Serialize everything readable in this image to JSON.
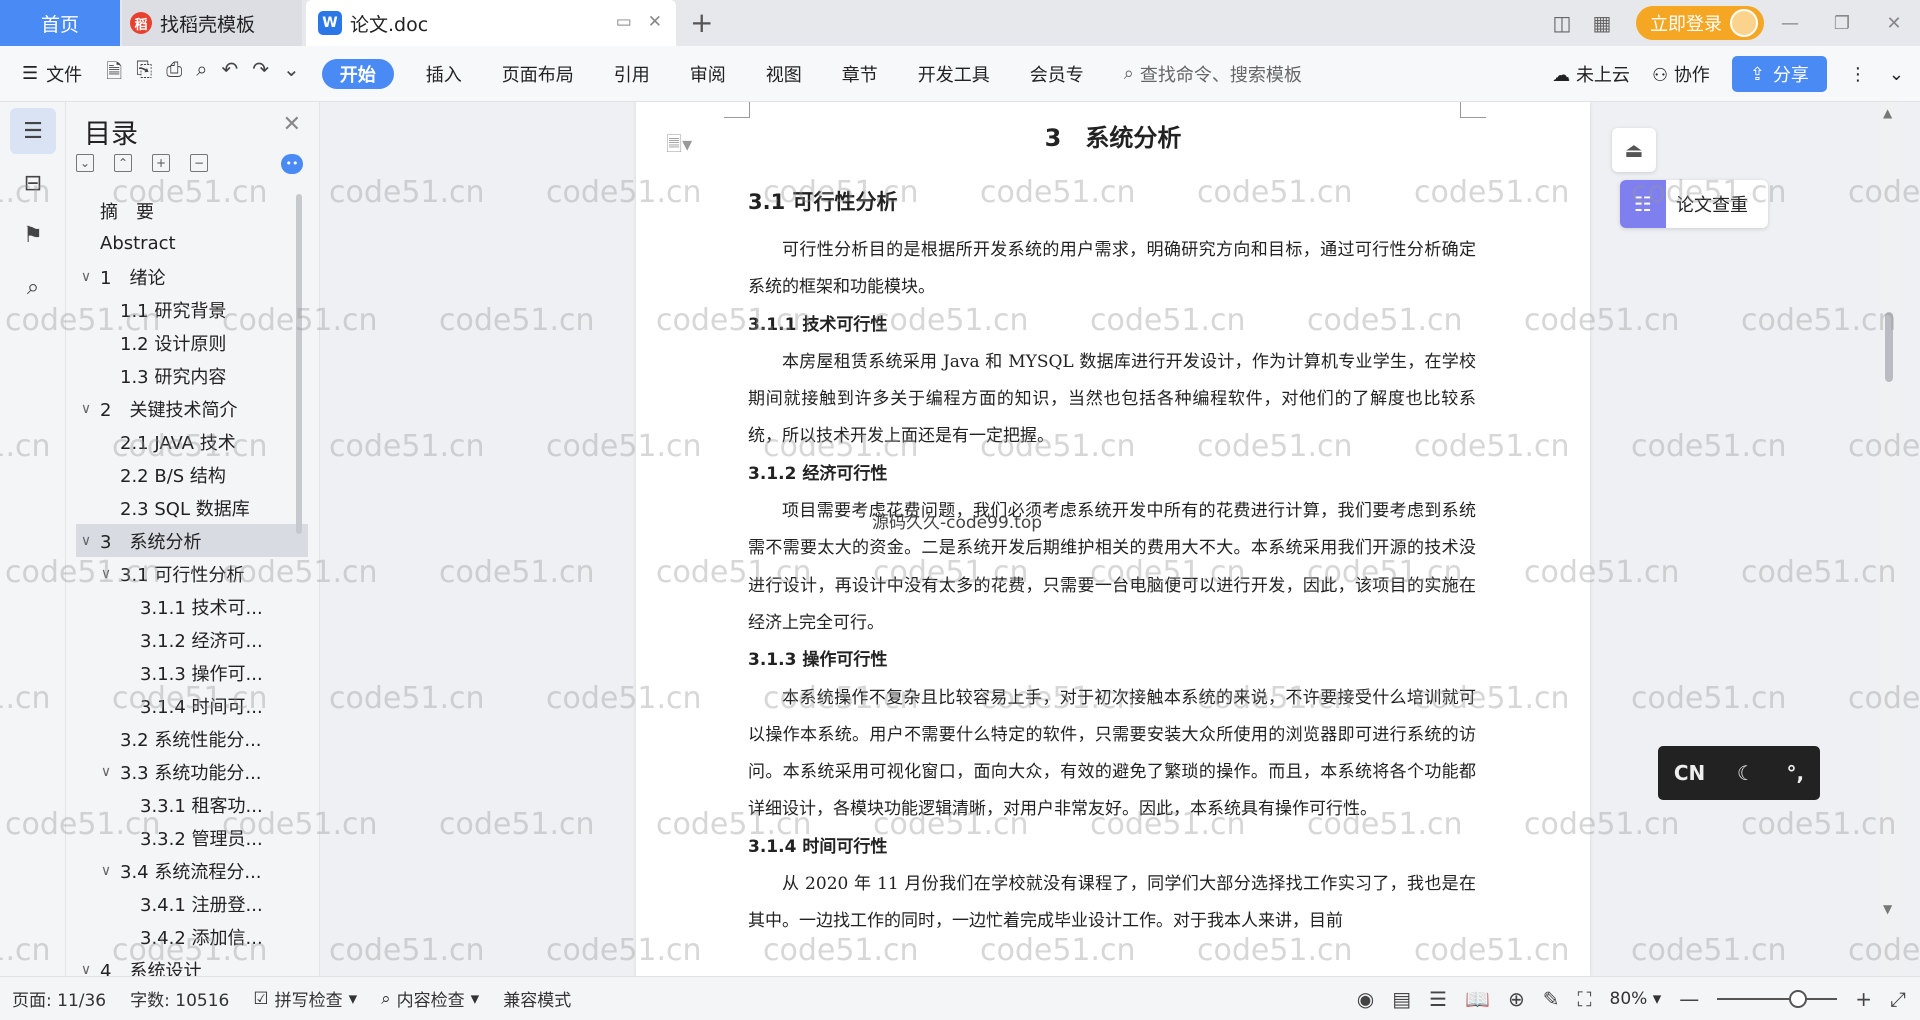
{
  "tabs": {
    "home": "首页",
    "zhaodao": "找稻壳模板",
    "doc": "论文.doc"
  },
  "titlebar": {
    "login": "立即登录"
  },
  "ribbon": {
    "file": "文件",
    "tabs": [
      "开始",
      "插入",
      "页面布局",
      "引用",
      "审阅",
      "视图",
      "章节",
      "开发工具",
      "会员专"
    ],
    "search_placeholder": "查找命令、搜索模板",
    "cloud": "未上云",
    "collab": "协作",
    "share": "分享"
  },
  "toc": {
    "title": "目录",
    "items": [
      {
        "label": "摘　要",
        "level": 0,
        "caret": ""
      },
      {
        "label": "Abstract",
        "level": 0,
        "caret": ""
      },
      {
        "label": "1　绪论",
        "level": 0,
        "caret": "∨"
      },
      {
        "label": "1.1 研究背景",
        "level": 1,
        "caret": ""
      },
      {
        "label": "1.2 设计原则",
        "level": 1,
        "caret": ""
      },
      {
        "label": "1.3 研究内容",
        "level": 1,
        "caret": ""
      },
      {
        "label": "2　关键技术简介",
        "level": 0,
        "caret": "∨"
      },
      {
        "label": "2.1 JAVA 技术",
        "level": 1,
        "caret": ""
      },
      {
        "label": "2.2 B/S 结构",
        "level": 1,
        "caret": ""
      },
      {
        "label": "2.3 SQL 数据库",
        "level": 1,
        "caret": ""
      },
      {
        "label": "3　系统分析",
        "level": 0,
        "caret": "∨",
        "selected": true
      },
      {
        "label": "3.1 可行性分析",
        "level": 1,
        "caret": "∨"
      },
      {
        "label": "3.1.1 技术可...",
        "level": 2,
        "caret": ""
      },
      {
        "label": "3.1.2 经济可...",
        "level": 2,
        "caret": ""
      },
      {
        "label": "3.1.3 操作可...",
        "level": 2,
        "caret": ""
      },
      {
        "label": "3.1.4 时间可...",
        "level": 2,
        "caret": ""
      },
      {
        "label": "3.2 系统性能分...",
        "level": 1,
        "caret": ""
      },
      {
        "label": "3.3 系统功能分...",
        "level": 1,
        "caret": "∨"
      },
      {
        "label": "3.3.1 租客功...",
        "level": 2,
        "caret": ""
      },
      {
        "label": "3.3.2 管理员...",
        "level": 2,
        "caret": ""
      },
      {
        "label": "3.4 系统流程分...",
        "level": 1,
        "caret": "∨"
      },
      {
        "label": "3.4.1 注册登...",
        "level": 2,
        "caret": ""
      },
      {
        "label": "3.4.2 添加信...",
        "level": 2,
        "caret": ""
      },
      {
        "label": "4　系统设计",
        "level": 0,
        "caret": "∨"
      }
    ]
  },
  "doc": {
    "chapter_title": "3　系统分析",
    "section_title": "3.1  可行性分析",
    "blocks": [
      {
        "type": "p",
        "text": "可行性分析目的是根据所开发系统的用户需求，明确研究方向和目标，通过可行性分析确定系统的框架和功能模块。"
      },
      {
        "type": "h",
        "text": "3.1.1  技术可行性"
      },
      {
        "type": "p",
        "text": "本房屋租赁系统采用 Java 和 MYSQL 数据库进行开发设计，作为计算机专业学生，在学校期间就接触到许多关于编程方面的知识，当然也包括各种编程软件，对他们的了解度也比较系统，所以技术开发上面还是有一定把握。"
      },
      {
        "type": "h",
        "text": "3.1.2  经济可行性"
      },
      {
        "type": "p",
        "text": "项目需要考虑花费问题，我们必须考虑系统开发中所有的花费进行计算，我们要考虑到系统需不需要太大的资金。二是系统开发后期维护相关的费用大不大。本系统采用我们开源的技术没进行设计，再设计中没有太多的花费，只需要一台电脑便可以进行开发，因此，该项目的实施在经济上完全可行。"
      },
      {
        "type": "h",
        "text": "3.1.3  操作可行性"
      },
      {
        "type": "p",
        "text": "本系统操作不复杂且比较容易上手，对于初次接触本系统的来说，不许要接受什么培训就可以操作本系统。用户不需要什么特定的软件，只需要安装大众所使用的浏览器即可进行系统的访问。本系统采用可视化窗口，面向大众，有效的避免了繁琐的操作。而且，本系统将各个功能都详细设计，各模块功能逻辑清晰，对用户非常友好。因此，本系统具有操作可行性。"
      },
      {
        "type": "h",
        "text": "3.1.4  时间可行性"
      },
      {
        "type": "p",
        "text": "从 2020 年 11 月份我们在学校就没有课程了，同学们大部分选择找工作实习了，我也是在其中。一边找工作的同时，一边忙着完成毕业设计工作。对于我本人来讲，目前"
      }
    ]
  },
  "floating": {
    "paper_check": "论文查重",
    "ime_lang": "CN"
  },
  "watermark": {
    "text": "code51.cn",
    "overlay": "源码久久-code99.top"
  },
  "status": {
    "page": "页面: 11/36",
    "words": "字数: 10516",
    "spell": "拼写检查",
    "content_check": "内容检查",
    "compat": "兼容模式",
    "zoom": "80%"
  },
  "colors": {
    "accent": "#4a8af4",
    "login": "#f5a623",
    "paper_check_icon": "#7f7ff0"
  }
}
